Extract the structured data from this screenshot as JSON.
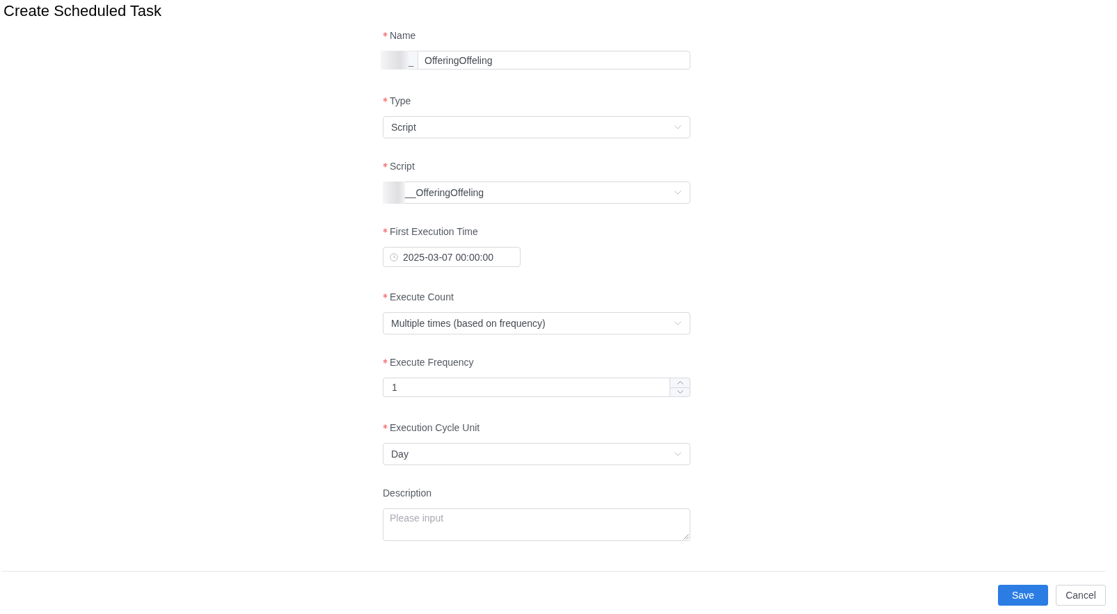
{
  "page": {
    "title": "Create Scheduled Task"
  },
  "form": {
    "fields": [
      {
        "kind": "prefixed_input",
        "label": "Name",
        "required": true,
        "prefix": "_",
        "prefix_redacted": true,
        "value": "OfferingOffeling"
      },
      {
        "kind": "select",
        "label": "Type",
        "required": true,
        "value": "Script"
      },
      {
        "kind": "select",
        "label": "Script",
        "required": true,
        "redacted": true,
        "value": "__OfferingOffeling"
      },
      {
        "kind": "datetime",
        "label": "First Execution Time",
        "required": true,
        "value": "2025-03-07 00:00:00"
      },
      {
        "kind": "select",
        "label": "Execute Count",
        "required": true,
        "value": "Multiple times (based on frequency)"
      },
      {
        "kind": "number",
        "label": "Execute Frequency",
        "required": true,
        "value": "1"
      },
      {
        "kind": "select",
        "label": "Execution Cycle Unit",
        "required": true,
        "value": "Day"
      },
      {
        "kind": "textarea",
        "label": "Description",
        "required": false,
        "placeholder": "Please input"
      }
    ]
  },
  "footer": {
    "buttons": [
      {
        "label": "Save",
        "kind": "primary"
      },
      {
        "label": "Cancel",
        "kind": "default"
      }
    ]
  }
}
